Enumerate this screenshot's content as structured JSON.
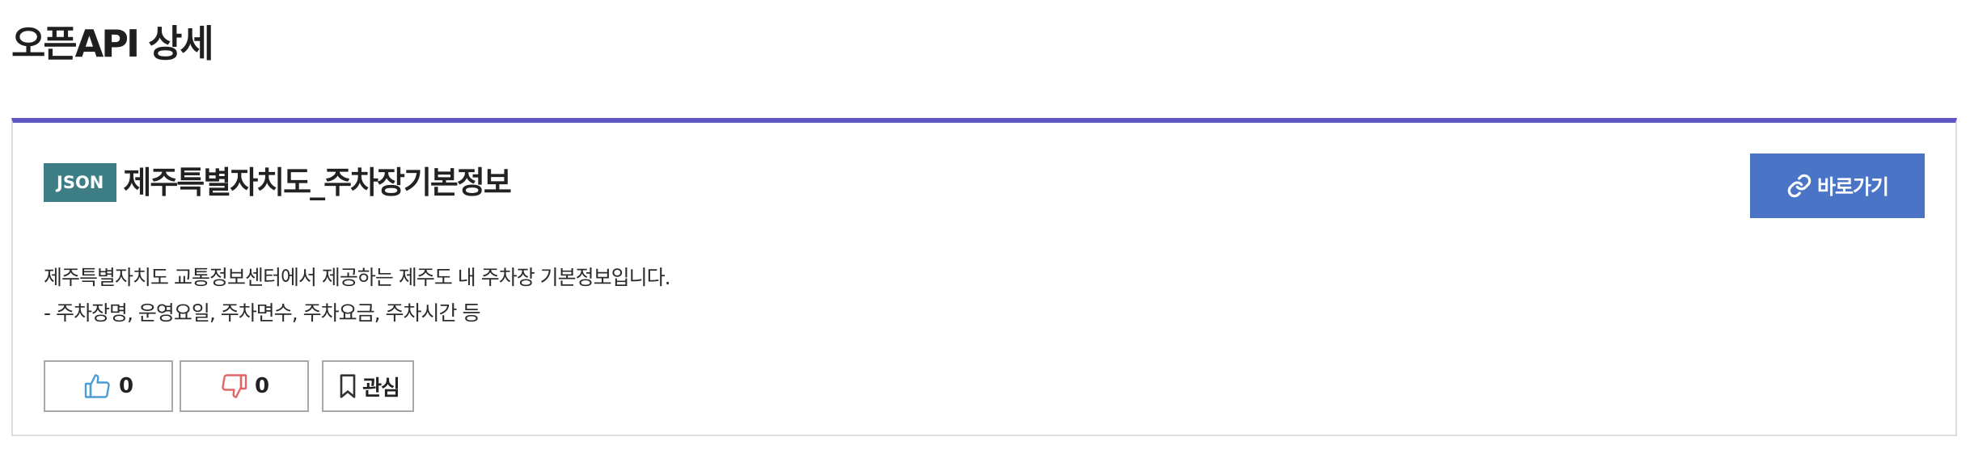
{
  "page": {
    "title": "오픈API 상세"
  },
  "card": {
    "format_badge": "JSON",
    "api_name": "제주특별자치도_주차장기본정보",
    "goto_label": "바로가기",
    "description_lines": [
      "제주특별자치도 교통정보센터에서 제공하는 제주도 내 주차장 기본정보입니다.",
      "- 주차장명, 운영요일, 주차면수, 주차요금, 주차시간 등"
    ],
    "accent_color": "#6157c4",
    "badge_color": "#3d7d85",
    "button_color": "#4a74c6"
  },
  "actions": {
    "like_count": "0",
    "dislike_count": "0",
    "favorite_label": "관심"
  },
  "icons": {
    "goto": "link-icon",
    "like": "thumbs-up-icon",
    "dislike": "thumbs-down-icon",
    "favorite": "bookmark-icon"
  }
}
